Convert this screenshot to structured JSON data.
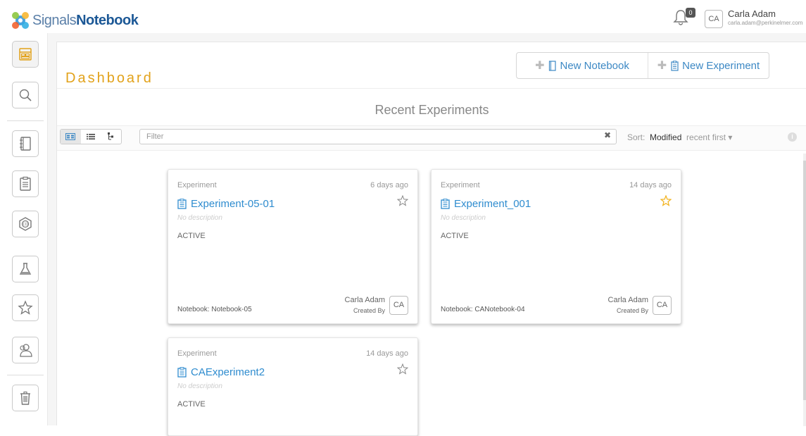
{
  "brand": {
    "part1": "Signals",
    "part2": "Notebook"
  },
  "header": {
    "notification_count": "0",
    "user_initials": "CA",
    "user_name": "Carla Adam",
    "user_email": "carla.adam@perkinelmer.com"
  },
  "sidebar": {
    "items": [
      {
        "name": "dashboard",
        "icon": "dashboard-icon"
      },
      {
        "name": "search",
        "icon": "search-icon"
      },
      {
        "name": "notebooks",
        "icon": "notebook-icon"
      },
      {
        "name": "experiments",
        "icon": "clipboard-icon"
      },
      {
        "name": "chemdraw",
        "icon": "hexagon-icon"
      },
      {
        "name": "materials",
        "icon": "flask-icon"
      },
      {
        "name": "favorites",
        "icon": "star-icon"
      },
      {
        "name": "users",
        "icon": "users-icon"
      },
      {
        "name": "trash",
        "icon": "trash-icon"
      }
    ]
  },
  "page": {
    "title": "Dashboard",
    "new_notebook_label": "New Notebook",
    "new_experiment_label": "New Experiment",
    "section_title": "Recent Experiments"
  },
  "toolbar": {
    "filter_placeholder": "Filter",
    "clear_symbol": "✖",
    "sort_label": "Sort:",
    "sort_key": "Modified",
    "sort_order": "recent first ▾",
    "info_symbol": "i"
  },
  "cards": [
    {
      "type": "Experiment",
      "when": "6 days ago",
      "title": "Experiment-05-01",
      "description": "No description",
      "status": "ACTIVE",
      "notebook": "Notebook: Notebook-05",
      "creator": "Carla Adam",
      "created_by_label": "Created By",
      "creator_initials": "CA",
      "starred": false
    },
    {
      "type": "Experiment",
      "when": "14 days ago",
      "title": "Experiment_001",
      "description": "No description",
      "status": "ACTIVE",
      "notebook": "Notebook: CANotebook-04",
      "creator": "Carla Adam",
      "created_by_label": "Created By",
      "creator_initials": "CA",
      "starred": true
    },
    {
      "type": "Experiment",
      "when": "14 days ago",
      "title": "CAExperiment2",
      "description": "No description",
      "status": "ACTIVE",
      "notebook": "",
      "creator": "",
      "created_by_label": "",
      "creator_initials": "",
      "starred": false
    }
  ],
  "colors": {
    "accent_orange": "#e2a21a",
    "link_blue": "#2f8ccf",
    "brand_blue": "#1c5896",
    "star_gold": "#f2b21b"
  }
}
